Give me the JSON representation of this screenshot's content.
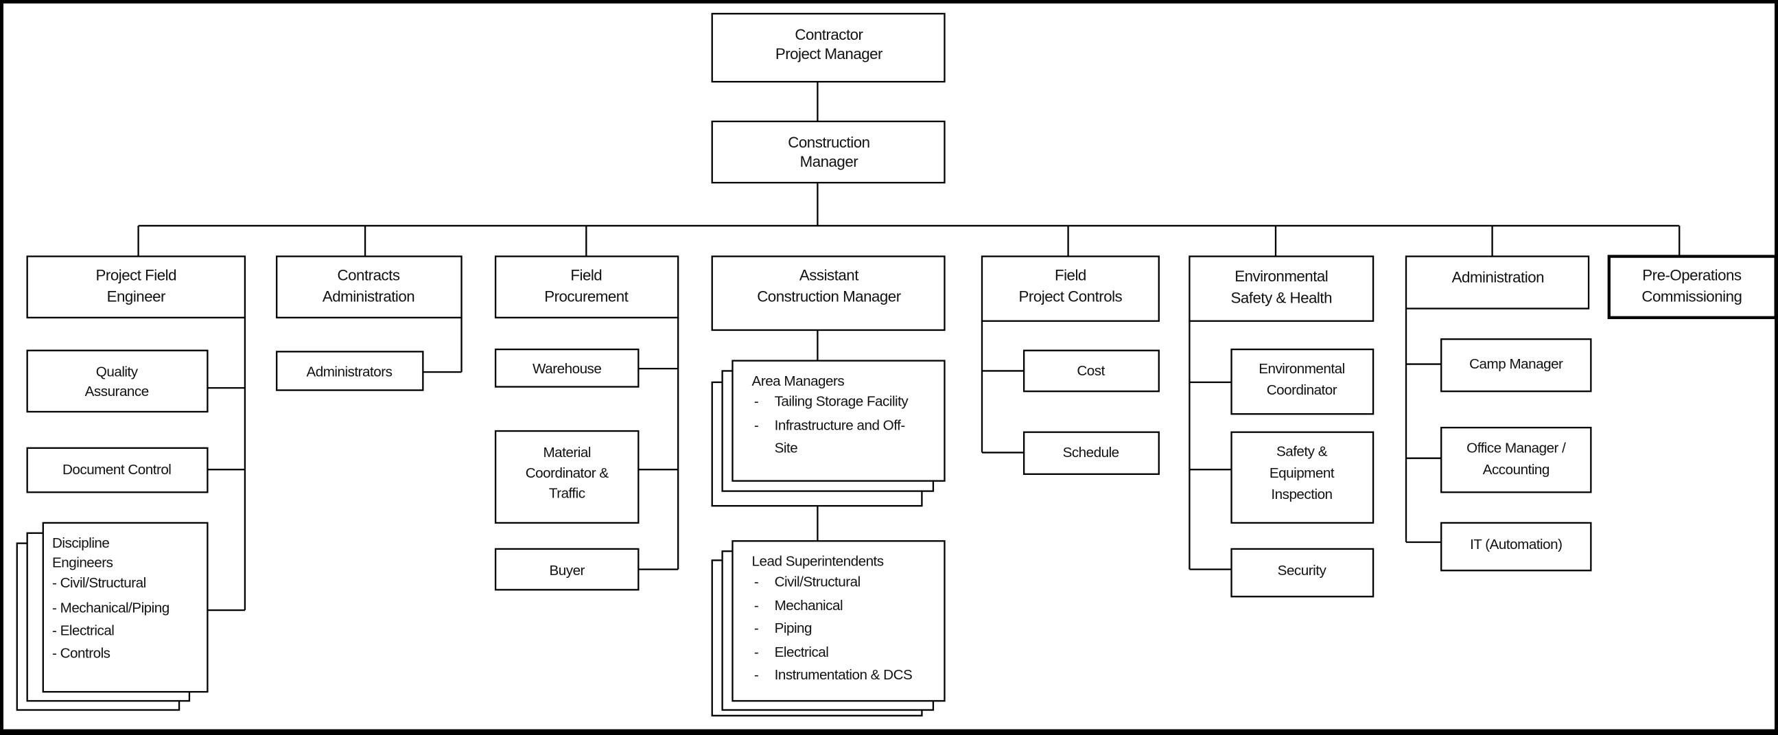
{
  "top": {
    "contractor_pm": [
      "Contractor",
      "Project Manager"
    ],
    "construction_manager": [
      "Construction",
      "Manager"
    ]
  },
  "departments": [
    {
      "title": [
        "Project Field",
        "Engineer"
      ],
      "children": [
        {
          "lines": [
            "Quality",
            "Assurance"
          ]
        },
        {
          "lines": [
            "Document Control"
          ]
        },
        {
          "header": [
            "Discipline",
            "Engineers"
          ],
          "items": [
            "- Civil/Structural",
            "- Mechanical/Piping",
            "- Electrical",
            "- Controls"
          ]
        }
      ]
    },
    {
      "title": [
        "Contracts",
        "Administration"
      ],
      "children": [
        {
          "lines": [
            "Administrators"
          ]
        }
      ]
    },
    {
      "title": [
        "Field",
        "Procurement"
      ],
      "children": [
        {
          "lines": [
            "Warehouse"
          ]
        },
        {
          "lines": [
            "Material",
            "Coordinator &",
            "Traffic"
          ]
        },
        {
          "lines": [
            "Buyer"
          ]
        }
      ]
    },
    {
      "title": [
        "Assistant",
        "Construction Manager"
      ],
      "children": [
        {
          "header": "Area Managers",
          "items": [
            "Tailing Storage Facility",
            "Infrastructure and Off-",
            "Site"
          ]
        },
        {
          "header": "Lead Superintendents",
          "items": [
            "Civil/Structural",
            "Mechanical",
            "Piping",
            "Electrical",
            "Instrumentation & DCS"
          ]
        }
      ]
    },
    {
      "title": [
        "Field",
        "Project Controls"
      ],
      "children": [
        {
          "lines": [
            "Cost"
          ]
        },
        {
          "lines": [
            "Schedule"
          ]
        }
      ]
    },
    {
      "title": [
        "Environmental",
        "Safety & Health"
      ],
      "children": [
        {
          "lines": [
            "Environmental",
            "Coordinator"
          ]
        },
        {
          "lines": [
            "Safety &",
            "Equipment",
            "Inspection"
          ]
        },
        {
          "lines": [
            "Security"
          ]
        }
      ]
    },
    {
      "title": [
        "Administration"
      ],
      "children": [
        {
          "lines": [
            "Camp Manager"
          ]
        },
        {
          "lines": [
            "Office Manager /",
            "Accounting"
          ]
        },
        {
          "lines": [
            "IT (Automation)"
          ]
        }
      ]
    },
    {
      "title": [
        "Pre-Operations",
        "Commissioning"
      ],
      "children": []
    }
  ],
  "bullet": "-",
  "colors": {
    "frame": "#000000",
    "box_fill": "#ffffff",
    "line": "#000000"
  }
}
